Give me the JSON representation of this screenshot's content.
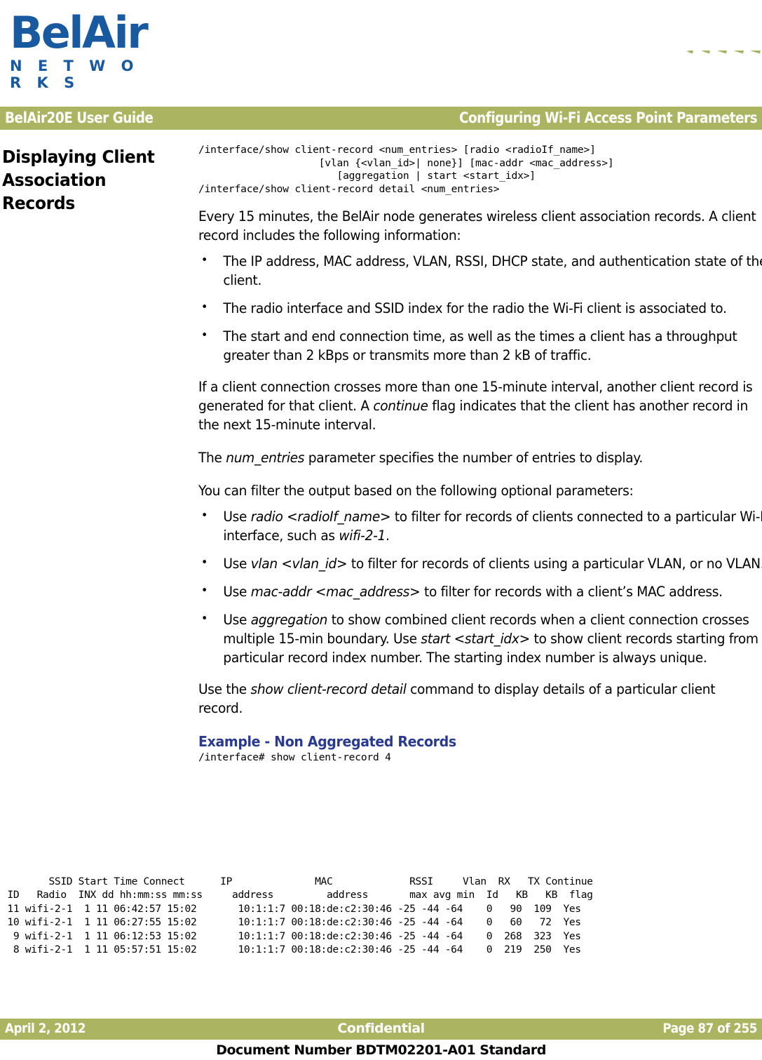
{
  "brand": {
    "logo_word": "BelAir",
    "logo_subtitle": "N E T W O R K S",
    "logo_color": "#19599f",
    "accent_green": "#aab461",
    "heading_blue": "#2a3b8f"
  },
  "header": {
    "left": "BelAir20E User Guide",
    "right": "Configuring Wi-Fi Access Point Parameters"
  },
  "side_heading": "Displaying Client Association Records",
  "syntax_block": "/interface/show client-record <num_entries> [radio <radioIf_name>]\n                    [vlan {<vlan_id>| none}] [mac-addr <mac_address>]\n                       [aggregation | start <start_idx>]\n/interface/show client-record detail <num_entries>",
  "paragraphs": {
    "intro": "Every 15 minutes, the BelAir node generates wireless client association records. A client record includes the following information:",
    "crossing_interval_1": "If a client connection crosses more than one 15-minute interval, another client record is generated for that client. A ",
    "crossing_interval_italic": "continue",
    "crossing_interval_2": " flag indicates that the client has another record in the next 15-minute interval.",
    "num_entries_1": "The ",
    "num_entries_italic": "num_entries",
    "num_entries_2": " parameter specifies the number of entries to display.",
    "filter_intro": "You can filter the output based on the following optional parameters:",
    "detail_1": "Use the ",
    "detail_italic": "show client-record detail",
    "detail_2": " command to display details of a particular client record."
  },
  "info_bullets": [
    "The IP address, MAC address, VLAN, RSSI, DHCP state, and authentication state of the client.",
    "The radio interface and SSID index for the radio the Wi-Fi client is associated to.",
    "The start and end connection time, as well as the times a client has a throughput greater than 2 kBps or transmits more than 2 kB of traffic."
  ],
  "filter_bullets": [
    {
      "p1": "Use ",
      "i1": "radio <radioIf_name>",
      "p2": " to filter for records of clients connected to a particular Wi-FI interface, such as ",
      "i2": "wifi-2-1",
      "p3": "."
    },
    {
      "p1": "Use ",
      "i1": "vlan <vlan_id>",
      "p2": " to filter for records of clients using a particular VLAN, or no VLAN.",
      "i2": "",
      "p3": ""
    },
    {
      "p1": "Use ",
      "i1": "mac-addr <mac_address>",
      "p2": " to filter for records with a client’s MAC address.",
      "i2": "",
      "p3": ""
    },
    {
      "p1": "Use ",
      "i1": "aggregation",
      "p2": " to show combined client records when a client connection crosses multiple 15-min boundary. Use ",
      "i2": "start <start_idx>",
      "p3": " to show client records starting from a particular record index number. The starting index number is always unique."
    }
  ],
  "example": {
    "heading": "Example - Non Aggregated Records",
    "command": "/interface# show client-record 4",
    "table": {
      "header_line_1": "        SSID Start Time Connect      IP              MAC             RSSI     Vlan  RX   TX Continue",
      "header_line_2": " ID   Radio  INX dd hh:mm:ss mm:ss     address         address       max avg min  Id   KB   KB  flag",
      "columns_top": [
        "",
        "",
        "SSID",
        "Start Time",
        "Connect",
        "IP",
        "MAC",
        "RSSI",
        "",
        "",
        "Vlan",
        "RX",
        "TX",
        "Continue"
      ],
      "columns_bottom": [
        "ID",
        "Radio",
        "INX",
        "dd hh:mm:ss",
        "mm:ss",
        "address",
        "address",
        "max",
        "avg",
        "min",
        "Id",
        "KB",
        "KB",
        "flag"
      ],
      "rows": [
        {
          "id": "11",
          "radio": "wifi-2-1",
          "ssid_inx": "1",
          "start_time": "11 06:42:57",
          "connect": "15:02",
          "ip_address": "10:1:1:7",
          "mac_address": "00:18:de:c2:30:46",
          "rssi_max": "-25",
          "rssi_avg": "-44",
          "rssi_min": "-64",
          "vlan_id": "0",
          "rx_kb": "90",
          "tx_kb": "109",
          "continue_flag": "Yes"
        },
        {
          "id": "10",
          "radio": "wifi-2-1",
          "ssid_inx": "1",
          "start_time": "11 06:27:55",
          "connect": "15:02",
          "ip_address": "10:1:1:7",
          "mac_address": "00:18:de:c2:30:46",
          "rssi_max": "-25",
          "rssi_avg": "-44",
          "rssi_min": "-64",
          "vlan_id": "0",
          "rx_kb": "60",
          "tx_kb": "72",
          "continue_flag": "Yes"
        },
        {
          "id": "9",
          "radio": "wifi-2-1",
          "ssid_inx": "1",
          "start_time": "11 06:12:53",
          "connect": "15:02",
          "ip_address": "10:1:1:7",
          "mac_address": "00:18:de:c2:30:46",
          "rssi_max": "-25",
          "rssi_avg": "-44",
          "rssi_min": "-64",
          "vlan_id": "0",
          "rx_kb": "268",
          "tx_kb": "323",
          "continue_flag": "Yes"
        },
        {
          "id": "8",
          "radio": "wifi-2-1",
          "ssid_inx": "1",
          "start_time": "11 05:57:51",
          "connect": "15:02",
          "ip_address": "10:1:1:7",
          "mac_address": "00:18:de:c2:30:46",
          "rssi_max": "-25",
          "rssi_avg": "-44",
          "rssi_min": "-64",
          "vlan_id": "0",
          "rx_kb": "219",
          "tx_kb": "250",
          "continue_flag": "Yes"
        }
      ]
    },
    "raw_output": "        SSID Start Time Connect      IP              MAC             RSSI     Vlan  RX   TX Continue\n ID   Radio  INX dd hh:mm:ss mm:ss     address         address       max avg min  Id   KB   KB  flag\n 11 wifi-2-1  1 11 06:42:57 15:02       10:1:1:7 00:18:de:c2:30:46 -25 -44 -64    0   90  109  Yes\n 10 wifi-2-1  1 11 06:27:55 15:02       10:1:1:7 00:18:de:c2:30:46 -25 -44 -64    0   60   72  Yes\n  9 wifi-2-1  1 11 06:12:53 15:02       10:1:1:7 00:18:de:c2:30:46 -25 -44 -64    0  268  323  Yes\n  8 wifi-2-1  1 11 05:57:51 15:02       10:1:1:7 00:18:de:c2:30:46 -25 -44 -64    0  219  250  Yes"
  },
  "footer": {
    "date": "April 2, 2012",
    "classification": "Confidential",
    "page": "Page 87 of 255",
    "document_number": "Document Number BDTM02201-A01 Standard"
  }
}
